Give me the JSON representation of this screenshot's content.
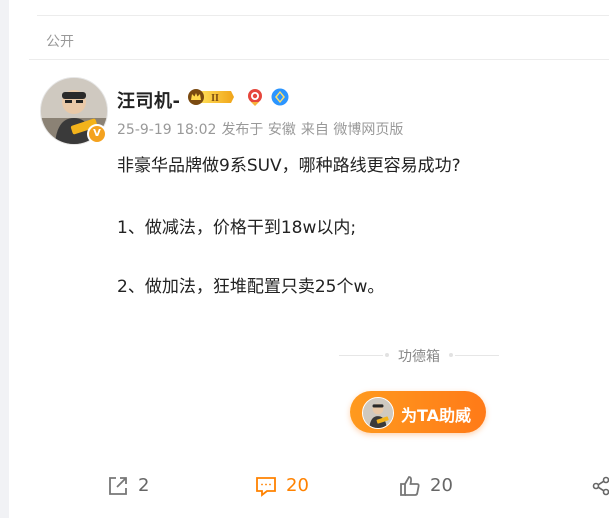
{
  "post": {
    "visibility": "公开",
    "author": {
      "name": "汪司机-",
      "vip_level": "II",
      "avatar_badge": "V"
    },
    "meta": {
      "date": "25-9-19 18:02",
      "published_in": "发布于 安徽",
      "source": "来自 微博网页版"
    },
    "content": {
      "line1": "非豪华品牌做9系SUV，哪种路线更容易成功?",
      "line2": "1、做减法，价格干到18w以内;",
      "line3": "2、做加法，狂堆配置只卖25个w。"
    },
    "gongde_label": "功德箱",
    "boost_button": "为TA助威",
    "actions": {
      "share_count": "2",
      "comment_count": "20",
      "like_count": "20"
    }
  },
  "colors": {
    "accent": "#ff8200",
    "vip_gold": "#f4a21f",
    "verified_blue": "#2b95ff"
  },
  "icons": [
    "share-icon",
    "comment-icon",
    "like-icon",
    "more-share-icon",
    "medal-icon",
    "diamond-icon",
    "vip-crown-icon"
  ]
}
